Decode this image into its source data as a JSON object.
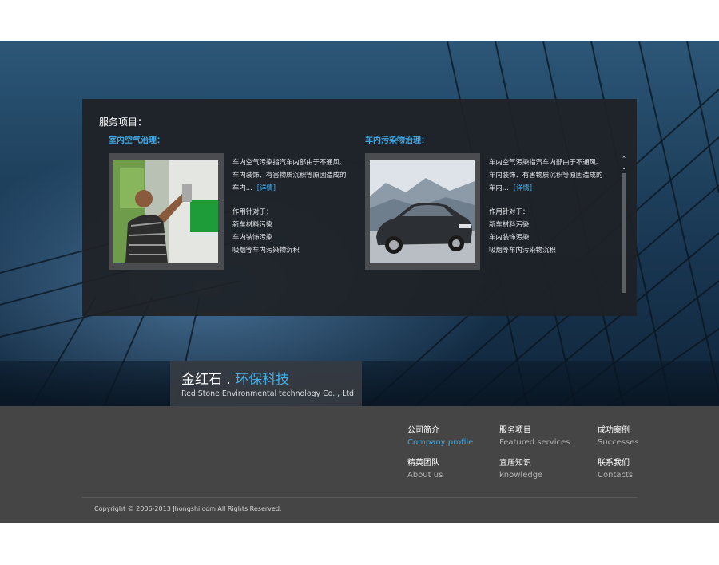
{
  "services": {
    "title": "服务项目：",
    "cards": [
      {
        "heading": "室内空气治理：",
        "desc_lines": [
          "车内空气污染指汽车内部由于不通风、",
          "车内装饰、有害物质沉积等原因造成的",
          "车内..."
        ],
        "more_label": "[详情]",
        "targets_label": "作用针对于：",
        "targets": [
          "新车材料污染",
          "车内装饰污染",
          "吸烟等车内污染物沉积"
        ]
      },
      {
        "heading": "车内污染物治理：",
        "desc_lines": [
          "车内空气污染指汽车内部由于不通风、",
          "车内装饰、有害物质沉积等原因造成的",
          "车内..."
        ],
        "more_label": "[详情]",
        "targets_label": "作用针对于：",
        "targets": [
          "新车材料污染",
          "车内装饰污染",
          "吸烟等车内污染物沉积"
        ]
      }
    ],
    "scroll_up_icon": "double-chevron-up-icon",
    "scroll_down_icon": "double-chevron-down-icon"
  },
  "brand": {
    "name_main": "金红石",
    "separator": " . ",
    "name_accent": "环保科技",
    "name_en": "Red Stone Environmental technology Co. , Ltd"
  },
  "footer_nav": [
    {
      "cn": "公司简介",
      "en": "Company profile",
      "active": true
    },
    {
      "cn": "服务项目",
      "en": "Featured services",
      "active": false
    },
    {
      "cn": "成功案例",
      "en": "Successes",
      "active": false
    },
    {
      "cn": "精英团队",
      "en": "About us",
      "active": false
    },
    {
      "cn": "宜居知识",
      "en": "knowledge",
      "active": false
    },
    {
      "cn": "联系我们",
      "en": "Contacts",
      "active": false
    }
  ],
  "copyright": "Copyright © 2006-2013 Jhongshi.com All Rights Reserved.",
  "colors": {
    "accent": "#42a9e6",
    "footer_bg": "#454545",
    "panel_bg": "#1e2126"
  }
}
